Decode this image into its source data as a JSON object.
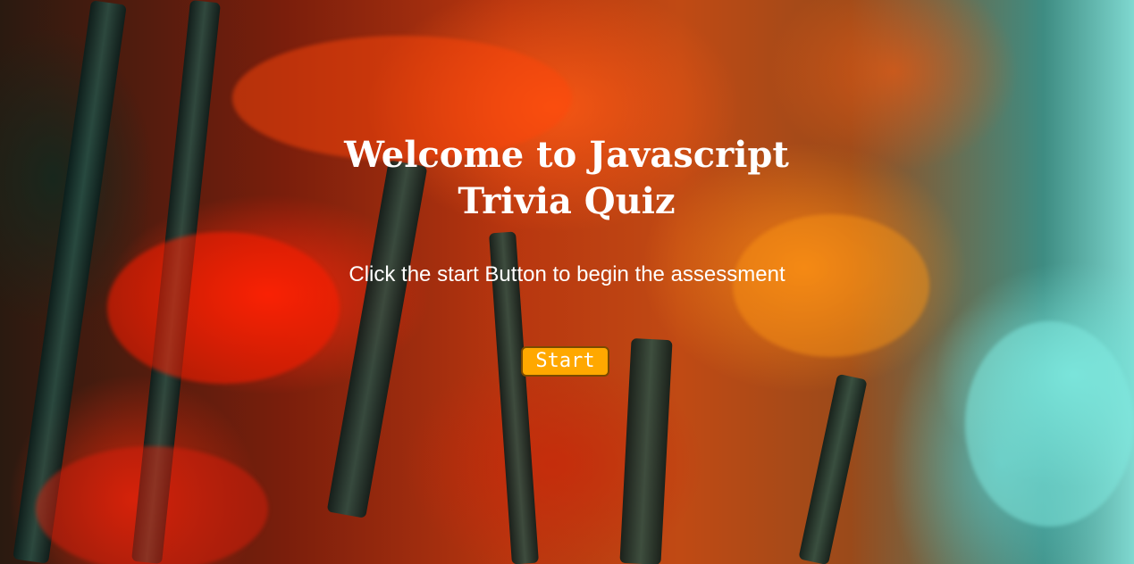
{
  "main": {
    "title_line1": "Welcome to Javascript",
    "title_line2": "Trivia Quiz",
    "instructions": "Click the start Button to begin the assessment",
    "start_button_label": "Start"
  },
  "colors": {
    "start_button_bg": "#ffa800",
    "text": "#ffffff"
  }
}
